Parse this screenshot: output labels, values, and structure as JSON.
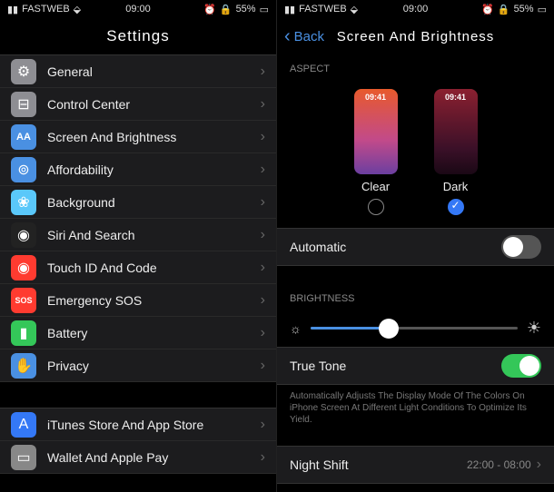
{
  "status": {
    "carrier": "FASTWEB",
    "time": "09:00",
    "battery": "55%"
  },
  "left": {
    "title": "Settings",
    "g1": [
      {
        "label": "General",
        "icon": "gear"
      },
      {
        "label": "Control Center",
        "icon": "cc"
      },
      {
        "label": "Screen And Brightness",
        "icon": "bright"
      },
      {
        "label": "Affordability",
        "icon": "afford"
      },
      {
        "label": "Background",
        "icon": "bg"
      },
      {
        "label": "Siri And Search",
        "icon": "siri"
      },
      {
        "label": "Touch ID And Code",
        "icon": "touch"
      },
      {
        "label": "Emergency SOS",
        "icon": "sos"
      },
      {
        "label": "Battery",
        "icon": "batt"
      },
      {
        "label": "Privacy",
        "icon": "priv"
      }
    ],
    "g2": [
      {
        "label": "iTunes Store And App Store",
        "icon": "store"
      },
      {
        "label": "Wallet And Apple Pay",
        "icon": "wallet"
      }
    ]
  },
  "right": {
    "back": "Back",
    "title": "Screen And Brightness",
    "aspect_section": "ASPECT",
    "clear_label": "Clear",
    "dark_label": "Dark",
    "thumb_time": "09:41",
    "automatic": "Automatic",
    "brightness_section": "Brightness",
    "true_tone": "True Tone",
    "true_tone_desc": "Automatically Adjusts The Display Mode Of The Colors On iPhone Screen At Different Light Conditions To Optimize Its Yield.",
    "night_shift": "Night Shift",
    "night_shift_val": "22:00 - 08:00"
  }
}
